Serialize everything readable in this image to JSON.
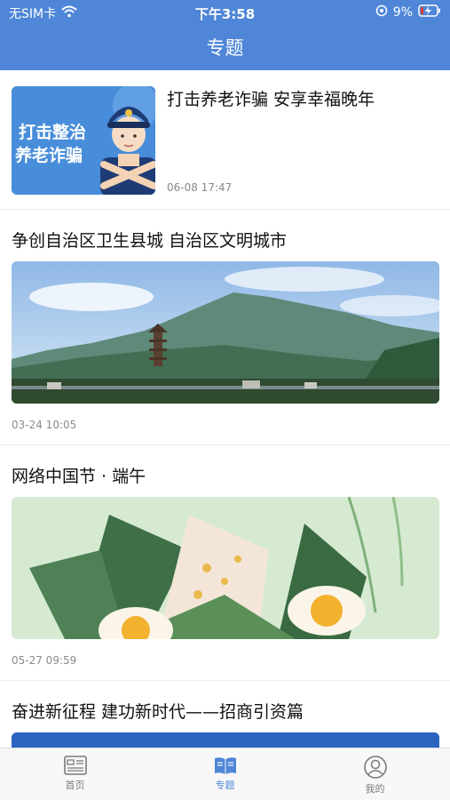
{
  "status": {
    "carrier": "无SIM卡",
    "time": "下午3:58",
    "battery": "9%"
  },
  "header": {
    "title": "专题"
  },
  "articles": [
    {
      "title": "打击养老诈骗 安享幸福晚年",
      "date": "06-08 17:47",
      "thumb_text": [
        "打击整治",
        "养老诈骗"
      ]
    },
    {
      "title": "争创自治区卫生县城 自治区文明城市",
      "date": "03-24 10:05"
    },
    {
      "title": "网络中国节 · 端午",
      "date": "05-27 09:59"
    },
    {
      "title": "奋进新征程 建功新时代——招商引资篇",
      "date": ""
    }
  ],
  "tabs": [
    {
      "label": "首页",
      "icon": "newspaper-icon"
    },
    {
      "label": "专题",
      "icon": "book-icon"
    },
    {
      "label": "我的",
      "icon": "user-icon"
    }
  ],
  "colors": {
    "accent": "#4f86d8",
    "tab_inactive": "#7a7a7a"
  }
}
